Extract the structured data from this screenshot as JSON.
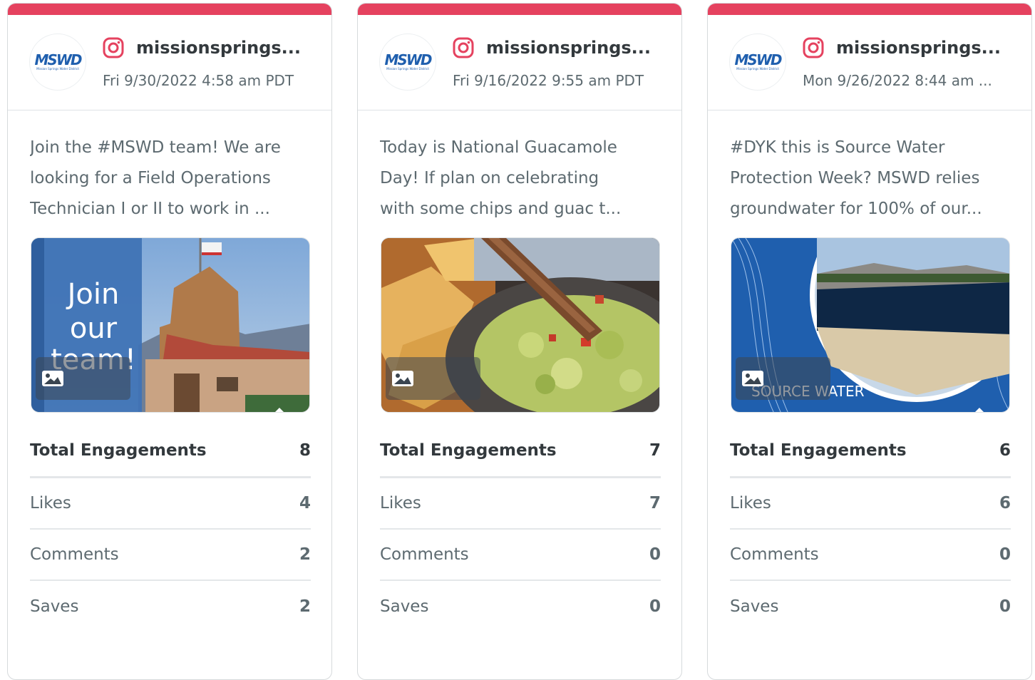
{
  "colors": {
    "accent": "#e5425f",
    "logo": "#1f5fae"
  },
  "cards": [
    {
      "avatar_text": "MSWD",
      "avatar_sub": "Mission Springs Water District",
      "platform_icon": "instagram-icon",
      "handle": "missionsprings...",
      "date": "Fri 9/30/2022 4:58 am PDT",
      "text_lines": [
        "Join the #MSWD team! We are",
        "looking for a Field Operations",
        "Technician I or II to work in ..."
      ],
      "image_text": "Join our team!",
      "total_label": "Total Engagements",
      "total_value": "8",
      "likes_label": "Likes",
      "likes_value": "4",
      "comments_label": "Comments",
      "comments_value": "2",
      "saves_label": "Saves",
      "saves_value": "2"
    },
    {
      "avatar_text": "MSWD",
      "avatar_sub": "Mission Springs Water District",
      "platform_icon": "instagram-icon",
      "handle": "missionsprings...",
      "date": "Fri 9/16/2022 9:55 am PDT",
      "text_lines": [
        "Today is National Guacamole",
        "Day! If plan on celebrating",
        "with some chips and guac t..."
      ],
      "image_text": "",
      "total_label": "Total Engagements",
      "total_value": "7",
      "likes_label": "Likes",
      "likes_value": "7",
      "comments_label": "Comments",
      "comments_value": "0",
      "saves_label": "Saves",
      "saves_value": "0"
    },
    {
      "avatar_text": "MSWD",
      "avatar_sub": "Mission Springs Water District",
      "platform_icon": "instagram-icon",
      "handle": "missionsprings...",
      "date": "Mon 9/26/2022 8:44 am ...",
      "text_lines": [
        "#DYK this is Source Water",
        "Protection Week? MSWD relies",
        "groundwater for 100% of our..."
      ],
      "image_text": "SOURCE WATER",
      "total_label": "Total Engagements",
      "total_value": "6",
      "likes_label": "Likes",
      "likes_value": "6",
      "comments_label": "Comments",
      "comments_value": "0",
      "saves_label": "Saves",
      "saves_value": "0"
    }
  ]
}
